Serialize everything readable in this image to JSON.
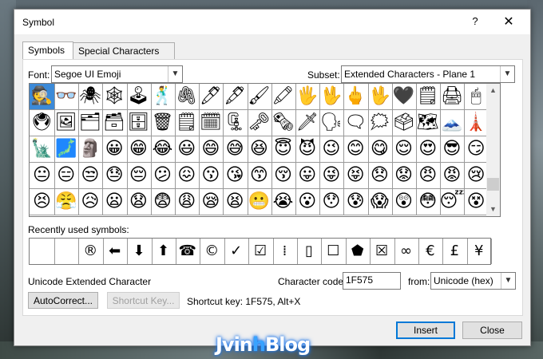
{
  "window": {
    "title": "Symbol",
    "help": "?",
    "close": "✕"
  },
  "tabs": [
    {
      "label": "Symbols",
      "active": true
    },
    {
      "label": "Special Characters",
      "active": false
    }
  ],
  "font": {
    "label": "Font:",
    "value": "Segoe UI Emoji"
  },
  "subset": {
    "label": "Subset:",
    "value": "Extended Characters - Plane 1"
  },
  "symbols_grid": {
    "rows": [
      [
        "🕵",
        "👓",
        "🕷",
        "🕸",
        "🕹",
        "🕺",
        "🖇",
        "🖊",
        "🖋",
        "🖌",
        "🖍",
        "🖐",
        "🖖",
        "🖕",
        "🖖",
        "🖤",
        "🗒",
        "🖨",
        "🖱"
      ],
      [
        "🖲",
        "🖼",
        "🗂",
        "🗃",
        "🗄",
        "🗑",
        "🗒",
        "🗓",
        "🗜",
        "🗝",
        "🗞",
        "🗡",
        "🗣",
        "🗨",
        "🗯",
        "🗳",
        "🗺",
        "🗻",
        "🗼"
      ],
      [
        "🗽",
        "🗾",
        "🗿",
        "😀",
        "😁",
        "😂",
        "😃",
        "😄",
        "😅",
        "😆",
        "😇",
        "😈",
        "😉",
        "😊",
        "😋",
        "😌",
        "😍",
        "😎",
        "😏"
      ],
      [
        "😐",
        "😑",
        "😒",
        "😓",
        "😔",
        "😕",
        "😖",
        "😗",
        "😘",
        "😙",
        "😚",
        "😛",
        "😜",
        "😝",
        "😞",
        "😟",
        "😠",
        "😡",
        "😢"
      ],
      [
        "😣",
        "😤",
        "😥",
        "😦",
        "😧",
        "😨",
        "😩",
        "😪",
        "😫",
        "😬",
        "😭",
        "😮",
        "😯",
        "😰",
        "😱",
        "😲",
        "😳",
        "😴",
        "😵"
      ]
    ],
    "selected_index": 0
  },
  "recent": {
    "label": "Recently used symbols:",
    "items": [
      "",
      "",
      "®",
      "⬅",
      "⬇",
      "⬆",
      "☎",
      "©",
      "✓",
      "☑",
      "⁞",
      "▯",
      "☐",
      "⬟",
      "☒",
      "∞",
      "€",
      "£",
      "¥"
    ]
  },
  "char_info": {
    "name": "Unicode Extended Character",
    "code_label": "Character code:",
    "code_value": "1F575",
    "from_label": "from:",
    "from_value": "Unicode (hex)"
  },
  "buttons": {
    "autocorrect": "AutoCorrect...",
    "shortcut_key": "Shortcut Key...",
    "insert": "Insert",
    "close": "Close"
  },
  "shortcut_text": "Shortcut key: 1F575, Alt+X",
  "watermark": {
    "left": "Jvin",
    "accent": "h",
    "right": "Blog"
  }
}
